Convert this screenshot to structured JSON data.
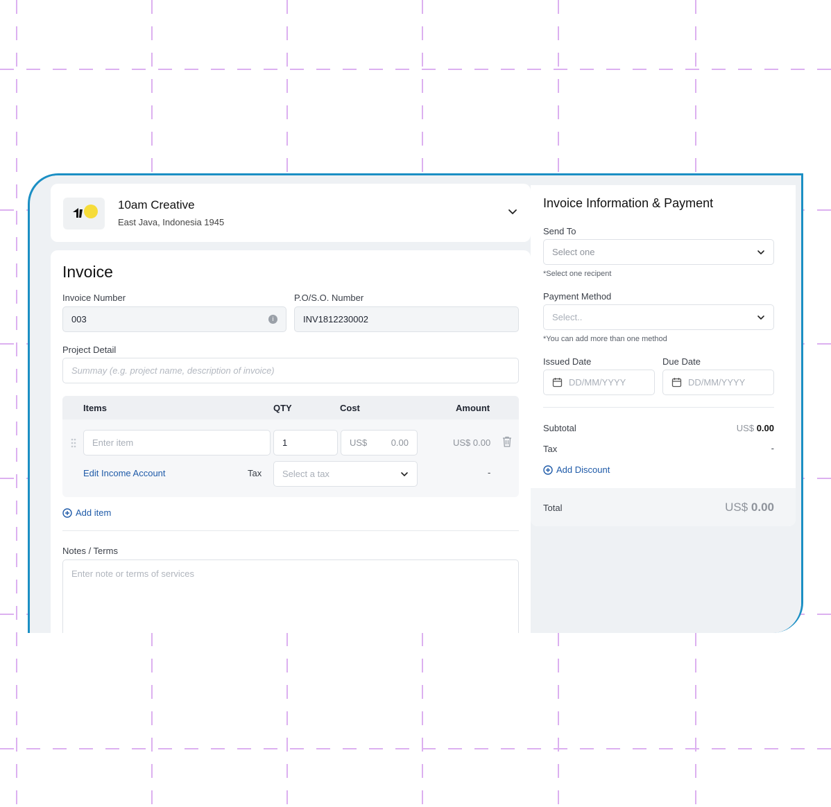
{
  "company": {
    "name": "10am Creative",
    "address": "East Java, Indonesia 1945"
  },
  "invoice": {
    "title": "Invoice",
    "invoice_number_label": "Invoice Number",
    "invoice_number_value": "003",
    "po_label": "P.O/S.O. Number",
    "po_value": "INV1812230002",
    "project_label": "Project Detail",
    "project_placeholder": "Summay (e.g. project name, description of invoice)",
    "items_table": {
      "headers": [
        "Items",
        "QTY",
        "Cost",
        "Amount"
      ],
      "row": {
        "item_placeholder": "Enter item",
        "qty": "1",
        "cost_currency": "US$",
        "cost_value": "0.00",
        "amount_currency": "US$",
        "amount_value": "0.00",
        "income_account_link": "Edit Income Account",
        "tax_label": "Tax",
        "tax_placeholder": "Select a tax",
        "tax_amount": "-"
      }
    },
    "add_item_label": "Add item",
    "notes_label": "Notes / Terms",
    "notes_placeholder": "Enter note or terms of services"
  },
  "payment": {
    "title": "Invoice Information & Payment",
    "send_to_label": "Send To",
    "send_to_placeholder": "Select one",
    "send_to_hint": "*Select one recipent",
    "method_label": "Payment Method",
    "method_placeholder": "Select..",
    "method_hint": "*You can add more than one method",
    "issued_label": "Issued Date",
    "issued_placeholder": "DD/MM/YYYY",
    "due_label": "Due Date",
    "due_placeholder": "DD/MM/YYYY",
    "subtotal_label": "Subtotal",
    "subtotal_currency": "US$",
    "subtotal_value": "0.00",
    "tax_label": "Tax",
    "tax_value": "-",
    "add_discount_label": "Add Discount",
    "total_label": "Total",
    "total_currency": "US$",
    "total_value": "0.00"
  },
  "colors": {
    "frame": "#1b8fc4",
    "link": "#1e5aa8",
    "grid": "#d9a6f2",
    "logo_yellow": "#f6dc3a"
  }
}
